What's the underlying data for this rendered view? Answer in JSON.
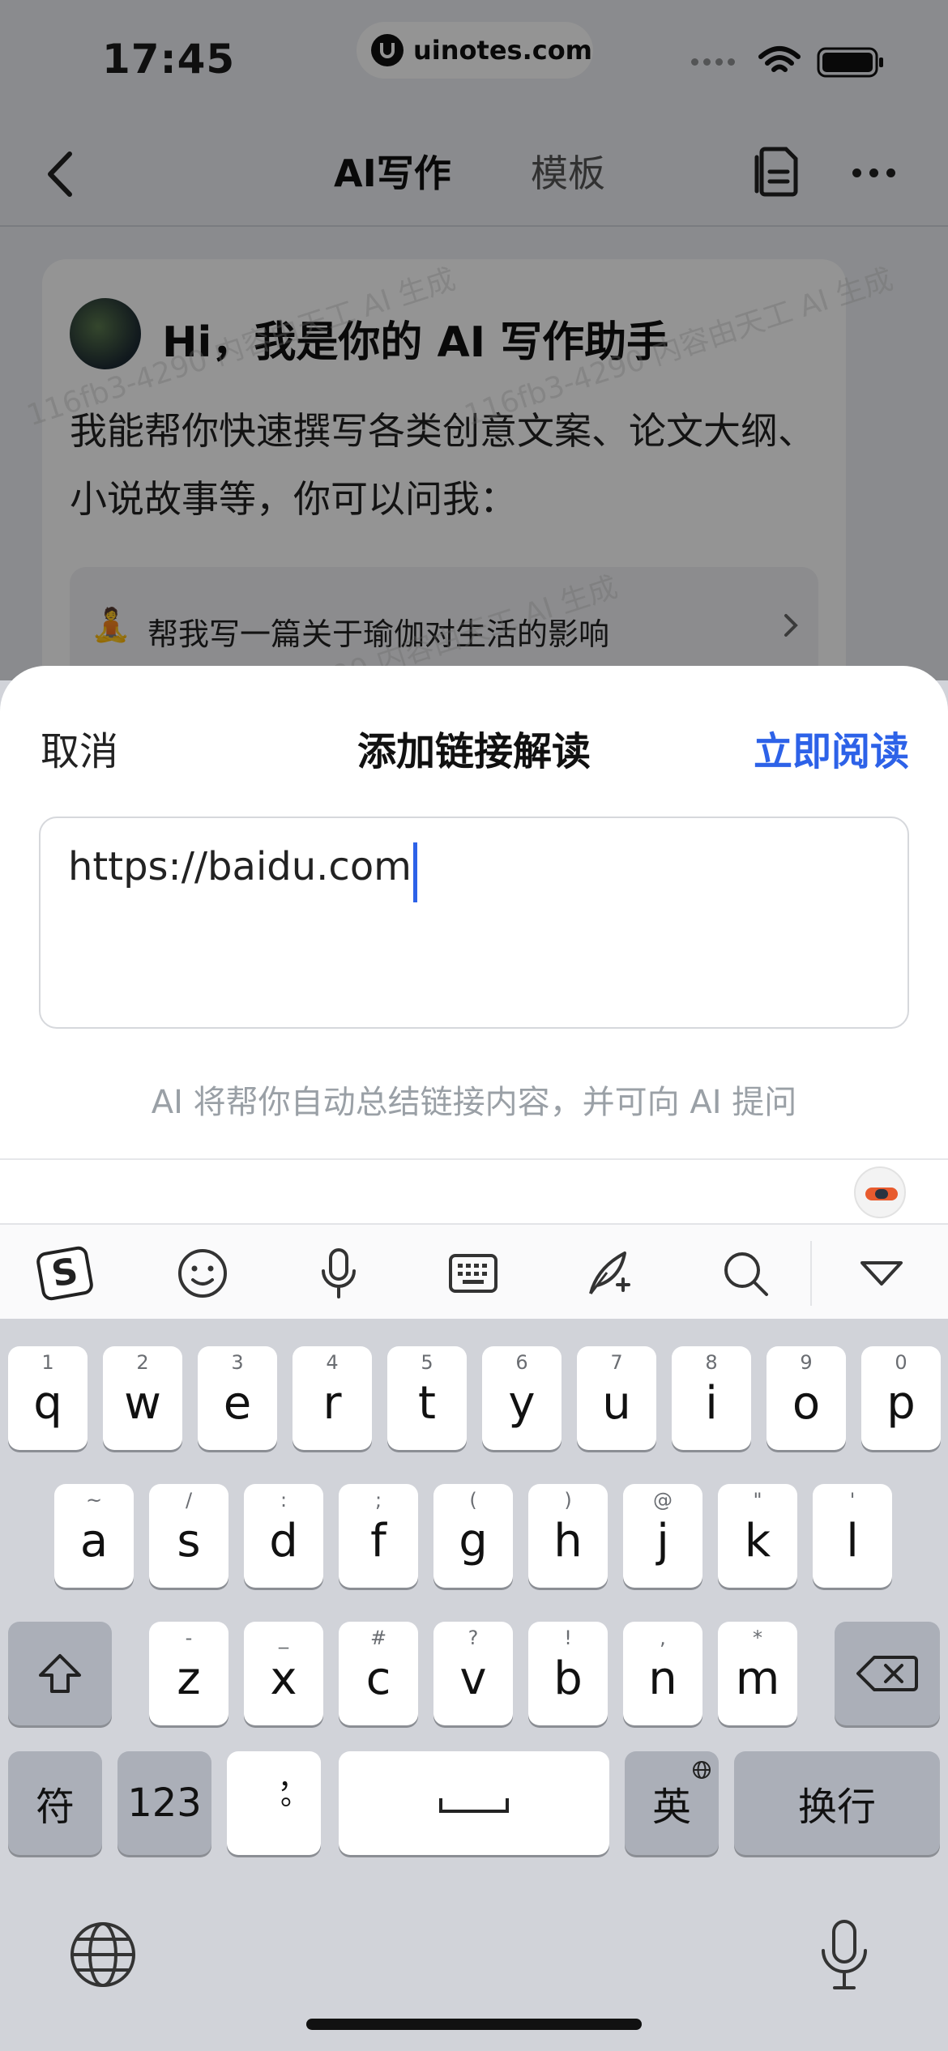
{
  "status_bar": {
    "time": "17:45",
    "site_badge": "uinotes.com"
  },
  "nav": {
    "tab_active": "AI写作",
    "tab_inactive": "模板"
  },
  "chat": {
    "greeting": "Hi，我是你的 AI 写作助手",
    "intro": "我能帮你快速撰写各类创意文案、论文大纲、小说故事等，你可以问我：",
    "suggestion": "帮我写一篇关于瑜伽对生活的影响",
    "suggestion_icon": "🧘"
  },
  "watermarks": [
    "116fb3-4290 内容由天工 AI 生成",
    "116fb3-4290 内容由天工 AI 生成",
    "116fb3-4290 内容由天工 AI 生成"
  ],
  "sheet": {
    "cancel_label": "取消",
    "title": "添加链接解读",
    "confirm_label": "立即阅读",
    "link_value": "https://baidu.com",
    "hint": "AI 将帮你自动总结链接内容，并可向 AI 提问"
  },
  "keyboard": {
    "row1": [
      {
        "ch": "q",
        "hint": "1"
      },
      {
        "ch": "w",
        "hint": "2"
      },
      {
        "ch": "e",
        "hint": "3"
      },
      {
        "ch": "r",
        "hint": "4"
      },
      {
        "ch": "t",
        "hint": "5"
      },
      {
        "ch": "y",
        "hint": "6"
      },
      {
        "ch": "u",
        "hint": "7"
      },
      {
        "ch": "i",
        "hint": "8"
      },
      {
        "ch": "o",
        "hint": "9"
      },
      {
        "ch": "p",
        "hint": "0"
      }
    ],
    "row2": [
      {
        "ch": "a",
        "hint": "~"
      },
      {
        "ch": "s",
        "hint": "/"
      },
      {
        "ch": "d",
        "hint": ":"
      },
      {
        "ch": "f",
        "hint": ";"
      },
      {
        "ch": "g",
        "hint": "("
      },
      {
        "ch": "h",
        "hint": ")"
      },
      {
        "ch": "j",
        "hint": "@"
      },
      {
        "ch": "k",
        "hint": "\""
      },
      {
        "ch": "l",
        "hint": "'"
      }
    ],
    "row3": [
      {
        "ch": "z",
        "hint": "-"
      },
      {
        "ch": "x",
        "hint": "_"
      },
      {
        "ch": "c",
        "hint": "#"
      },
      {
        "ch": "v",
        "hint": "?"
      },
      {
        "ch": "b",
        "hint": "!"
      },
      {
        "ch": "n",
        "hint": ","
      },
      {
        "ch": "m",
        "hint": "*"
      }
    ],
    "symbols_label": "符",
    "numbers_label": "123",
    "punct_label": "，。",
    "lang_label": "英",
    "return_label": "换行"
  },
  "colors": {
    "accent": "#2d62e8",
    "key_bg": "#ffffff",
    "fn_key_bg": "#abafb8",
    "keyboard_bg": "#d1d3d9"
  }
}
